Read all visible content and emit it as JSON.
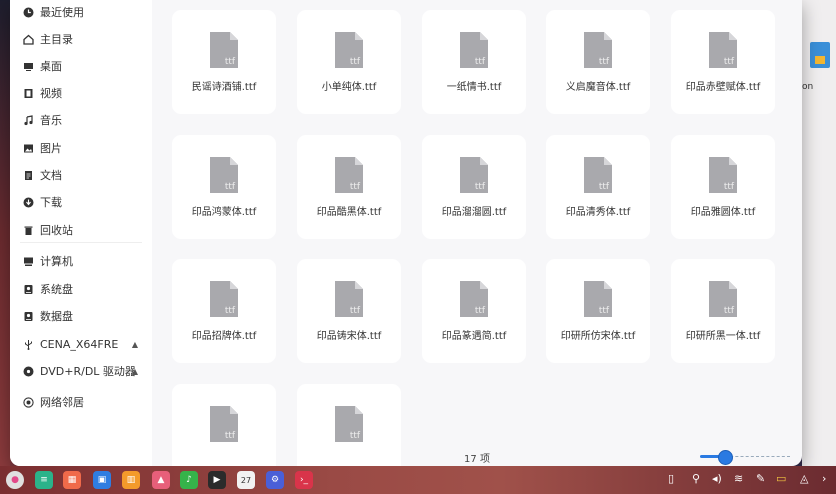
{
  "sidebar": {
    "items": [
      {
        "label": "最近使用",
        "icon": "clock-icon"
      },
      {
        "label": "主目录",
        "icon": "home-icon"
      },
      {
        "label": "桌面",
        "icon": "desktop-icon"
      },
      {
        "label": "视频",
        "icon": "video-icon"
      },
      {
        "label": "音乐",
        "icon": "music-icon"
      },
      {
        "label": "图片",
        "icon": "picture-icon"
      },
      {
        "label": "文档",
        "icon": "document-icon"
      },
      {
        "label": "下载",
        "icon": "download-icon"
      },
      {
        "label": "回收站",
        "icon": "trash-icon"
      },
      {
        "label": "计算机",
        "icon": "computer-icon"
      },
      {
        "label": "系统盘",
        "icon": "disk-icon"
      },
      {
        "label": "数据盘",
        "icon": "disk-icon"
      },
      {
        "label": "CENA_X64FRE",
        "icon": "usb-icon",
        "eject": "▲"
      },
      {
        "label": "DVD+R/DL 驱动器",
        "icon": "optical-drive-icon",
        "eject": "▲"
      },
      {
        "label": "网络邻居",
        "icon": "network-icon"
      }
    ]
  },
  "files": [
    {
      "name": "民谣诗酒铺.ttf",
      "badge": "ttf"
    },
    {
      "name": "小单纯体.ttf",
      "badge": "ttf"
    },
    {
      "name": "一纸情书.ttf",
      "badge": "ttf"
    },
    {
      "name": "义启魔音体.ttf",
      "badge": "ttf"
    },
    {
      "name": "印品赤壁赋体.ttf",
      "badge": "ttf"
    },
    {
      "name": "印品鸿蒙体.ttf",
      "badge": "ttf"
    },
    {
      "name": "印品酷黑体.ttf",
      "badge": "ttf"
    },
    {
      "name": "印品溜溜圆.ttf",
      "badge": "ttf"
    },
    {
      "name": "印品清秀体.ttf",
      "badge": "ttf"
    },
    {
      "name": "印品雅圆体.ttf",
      "badge": "ttf"
    },
    {
      "name": "印品招牌体.ttf",
      "badge": "ttf"
    },
    {
      "name": "印品铸宋体.ttf",
      "badge": "ttf"
    },
    {
      "name": "印品篆遇简.ttf",
      "badge": "ttf"
    },
    {
      "name": "印研所仿宋体.ttf",
      "badge": "ttf"
    },
    {
      "name": "印研所黑一体.ttf",
      "badge": "ttf"
    },
    {
      "name": "",
      "badge": "ttf"
    },
    {
      "name": "",
      "badge": "ttf"
    }
  ],
  "status": {
    "count_text": "17 项",
    "zoom_fraction": 0.25
  },
  "desktop": {
    "partial_label": "on"
  },
  "taskbar": {
    "apps": [
      {
        "icon": "launcher-icon",
        "color": "#e0e0e0"
      },
      {
        "icon": "multitask-view-icon",
        "color": "#2bb38a"
      },
      {
        "icon": "app-store-icon",
        "color": "#f06a4a"
      },
      {
        "icon": "file-manager-icon",
        "color": "#2f7de1"
      },
      {
        "icon": "app-grid-icon",
        "color": "#f39a2b"
      },
      {
        "icon": "gallery-icon",
        "color": "#e75f7a"
      },
      {
        "icon": "music-player-icon",
        "color": "#36b34a"
      },
      {
        "icon": "video-player-icon",
        "color": "#2b2b2b"
      },
      {
        "icon": "calendar-icon",
        "color": "#f2f2f2",
        "text": "27"
      },
      {
        "icon": "settings-icon",
        "color": "#4a5fd8"
      },
      {
        "icon": "terminal-icon",
        "color": "#d9344a"
      }
    ],
    "tray": [
      "trash-icon",
      "usb-icon",
      "volume-icon",
      "wifi-icon",
      "pen-icon",
      "battery-icon",
      "notification-icon",
      "chevron-right-icon"
    ],
    "accent": "#2a7ae2"
  }
}
